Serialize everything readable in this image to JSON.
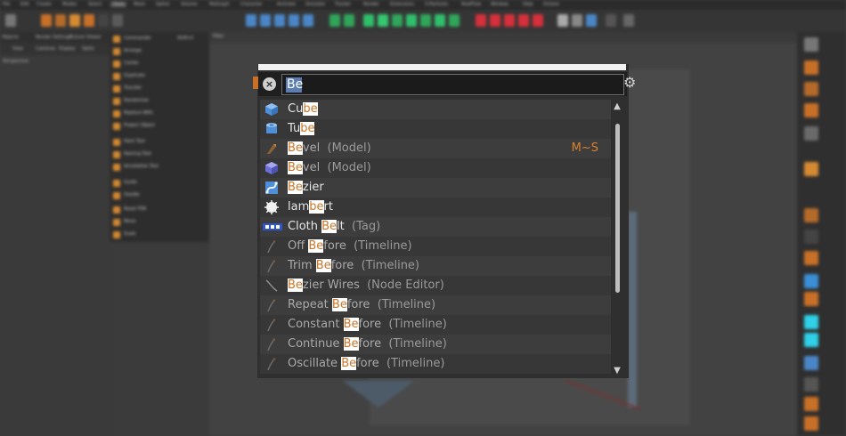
{
  "menubar": {
    "items": [
      "File",
      "Edit",
      "Create",
      "Modes",
      "Select",
      "Tools",
      "Mesh",
      "Spline",
      "Volume",
      "MoGraph",
      "Character",
      "Animate",
      "Simulate",
      "Tracker",
      "Render",
      "Extensions",
      "X-Particles",
      "RealFlow",
      "Window",
      "Help",
      "Octane"
    ],
    "active_index": 5
  },
  "left_panel": {
    "tabs": [
      "Objects",
      "Render Settings",
      "Picture Viewer"
    ],
    "menu": [
      "View",
      "Cameras",
      "Display",
      "Optio"
    ],
    "viewport_name": "Perspective"
  },
  "tools_menu": {
    "title": "Commander",
    "shortcut": "Shift+C",
    "items": [
      "Arrange",
      "Center",
      "Duplicate",
      "Transfer",
      "Randomize",
      "Replace With",
      "Project Object",
      "Paint Tool",
      "Naming Tool",
      "Annotation Tool",
      "Guide",
      "Doodle",
      "Reset PSR",
      "Move",
      "Scale",
      "Rotate"
    ]
  },
  "viewport": {
    "header": "Filter"
  },
  "commander": {
    "query": "Be",
    "clear_label": "×",
    "scroll_up": "▲",
    "scroll_down": "▼",
    "rows": [
      {
        "pre": "Cu",
        "match": "be",
        "post": "",
        "ctx": "",
        "shortcut": "",
        "icon": "cube-icon",
        "dim": false
      },
      {
        "pre": "Tu",
        "match": "be",
        "post": "",
        "ctx": "",
        "shortcut": "",
        "icon": "tube-icon",
        "dim": false
      },
      {
        "pre": "",
        "match": "Be",
        "post": "vel",
        "ctx": "(Model)",
        "shortcut": "M~S",
        "icon": "bevel-tool-icon",
        "dim": true
      },
      {
        "pre": "",
        "match": "Be",
        "post": "vel",
        "ctx": "(Model)",
        "shortcut": "",
        "icon": "bevel-deformer-icon",
        "dim": true
      },
      {
        "pre": "",
        "match": "Be",
        "post": "zier",
        "ctx": "",
        "shortcut": "",
        "icon": "bezier-icon",
        "dim": false
      },
      {
        "pre": "lam",
        "match": "be",
        "post": "rt",
        "ctx": "",
        "shortcut": "",
        "icon": "lambert-shader-icon",
        "dim": false
      },
      {
        "pre": "Cloth ",
        "match": "Be",
        "post": "lt",
        "ctx": "(Tag)",
        "shortcut": "",
        "icon": "cloth-belt-tag-icon",
        "dim": false
      },
      {
        "pre": "Off ",
        "match": "Be",
        "post": "fore",
        "ctx": "(Timeline)",
        "shortcut": "",
        "icon": "timeline-curve-icon",
        "dim": true
      },
      {
        "pre": "Trim ",
        "match": "Be",
        "post": "fore",
        "ctx": "(Timeline)",
        "shortcut": "",
        "icon": "timeline-curve-icon",
        "dim": true
      },
      {
        "pre": "",
        "match": "Be",
        "post": "zier Wires",
        "ctx": "(Node Editor)",
        "shortcut": "",
        "icon": "node-wire-icon",
        "dim": true
      },
      {
        "pre": "Repeat ",
        "match": "Be",
        "post": "fore",
        "ctx": "(Timeline)",
        "shortcut": "",
        "icon": "timeline-curve-icon",
        "dim": true
      },
      {
        "pre": "Constant ",
        "match": "Be",
        "post": "fore",
        "ctx": "(Timeline)",
        "shortcut": "",
        "icon": "timeline-curve-icon",
        "dim": true
      },
      {
        "pre": "Continue ",
        "match": "Be",
        "post": "fore",
        "ctx": "(Timeline)",
        "shortcut": "",
        "icon": "timeline-curve-icon",
        "dim": true
      },
      {
        "pre": "Oscillate ",
        "match": "Be",
        "post": "fore",
        "ctx": "(Timeline)",
        "shortcut": "",
        "icon": "timeline-curve-icon",
        "dim": true
      }
    ]
  }
}
